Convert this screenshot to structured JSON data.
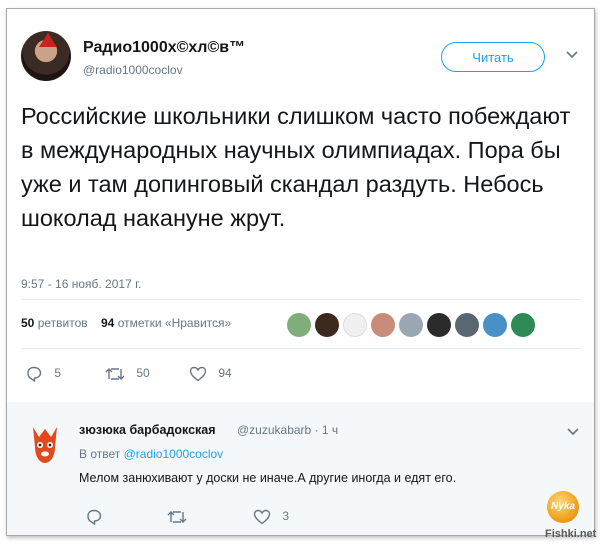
{
  "tweet": {
    "author_name": "Радио1000х©хл©в™",
    "author_handle": "@radio1000coclov",
    "follow_label": "Читать",
    "text": "Российские школьники слишком часто побеждают в международных научных олимпиадах. Пора бы уже и там допинговый скандал раздуть. Небось шоколад накануне жрут.",
    "timestamp": "9:57 - 16 нояб. 2017 г.",
    "retweets_count": "50",
    "retweets_label": "ретвитов",
    "likes_count": "94",
    "likes_label": "отметки «Нравится»",
    "actions": {
      "reply_count": "5",
      "retweet_count": "50",
      "like_count": "94"
    }
  },
  "reply": {
    "author_name": "зюзюка барбадокская",
    "author_handle": "@zuzukabarb",
    "time": "· 1 ч",
    "in_reply_prefix": "В ответ",
    "in_reply_handle": "@radio1000coclov",
    "text": "Мелом занюхивают  у доски не иначе.А другие иногда и едят его.",
    "actions": {
      "reply_count": "",
      "retweet_count": "",
      "like_count": "3"
    }
  },
  "watermark": {
    "logo_text": "Nyka",
    "site": "Fishki.net"
  },
  "colors": {
    "accent": "#1da1f2",
    "muted": "#657786",
    "text": "#14171a"
  }
}
